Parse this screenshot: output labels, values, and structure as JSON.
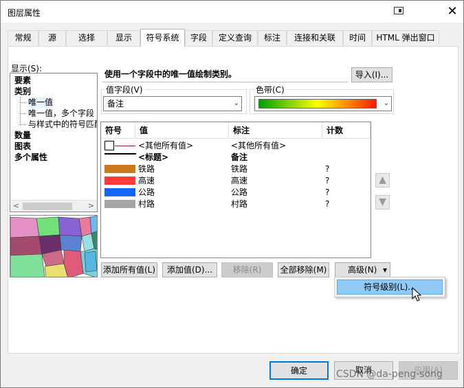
{
  "window": {
    "title": "图层属性",
    "close_glyph": "✕"
  },
  "tabs": [
    {
      "label": "常规"
    },
    {
      "label": "源"
    },
    {
      "label": "选择"
    },
    {
      "label": "显示"
    },
    {
      "label": "符号系统",
      "active": true
    },
    {
      "label": "字段"
    },
    {
      "label": "定义查询"
    },
    {
      "label": "标注"
    },
    {
      "label": "连接和关联"
    },
    {
      "label": "时间"
    },
    {
      "label": "HTML 弹出窗口"
    }
  ],
  "sidebar": {
    "show_label": "显示(S):",
    "tree": [
      {
        "label": "要素",
        "bold": true
      },
      {
        "label": "类别",
        "bold": true
      },
      {
        "label": "唯一值",
        "sub": true
      },
      {
        "label": "唯一值，多个字段",
        "sub": true
      },
      {
        "label": "与样式中的符号匹配",
        "sub": true
      },
      {
        "label": "数量",
        "bold": true
      },
      {
        "label": "图表",
        "bold": true
      },
      {
        "label": "多个属性",
        "bold": true
      }
    ],
    "scroll_left": "<",
    "scroll_right": ">"
  },
  "main": {
    "description": "使用一个字段中的唯一值绘制类别。",
    "import_button": "导入(I)...",
    "value_field_label": "值字段(V)",
    "value_field_value": "备注",
    "color_ramp_label": "色带(C)",
    "color_ramp_colors": [
      "#00a000",
      "#7fd000",
      "#ffff00",
      "#ff8c00",
      "#ff1a00"
    ]
  },
  "table": {
    "headers": {
      "symbol": "符号",
      "value": "值",
      "label": "标注",
      "count": "计数"
    },
    "other_row": {
      "value": "<其他所有值>",
      "label": "<其他所有值>"
    },
    "heading_row": {
      "value": "<标题>",
      "label": "备注"
    },
    "rows": [
      {
        "value": "铁路",
        "label": "铁路",
        "count": "?",
        "color": "#cc7a1c"
      },
      {
        "value": "高速",
        "label": "高速",
        "count": "?",
        "color": "#ff3b3b"
      },
      {
        "value": "公路",
        "label": "公路",
        "count": "?",
        "color": "#1466ff"
      },
      {
        "value": "村路",
        "label": "村路",
        "count": "?",
        "color": "#a5a5a5"
      }
    ]
  },
  "side_buttons": {
    "up": "▲",
    "down": "▼"
  },
  "action_buttons": {
    "add_all": "添加所有值(L)",
    "add_values": "添加值(D)...",
    "remove": "移除(R)",
    "remove_all": "全部移除(M)",
    "advanced": "高级(N)",
    "advanced_arrow": "▾"
  },
  "advanced_menu": {
    "item": "符号级别(L)..."
  },
  "footer": {
    "ok": "确定",
    "cancel": "取消",
    "apply": "应用(A)"
  },
  "watermark": "CSDN @da-peng-song"
}
